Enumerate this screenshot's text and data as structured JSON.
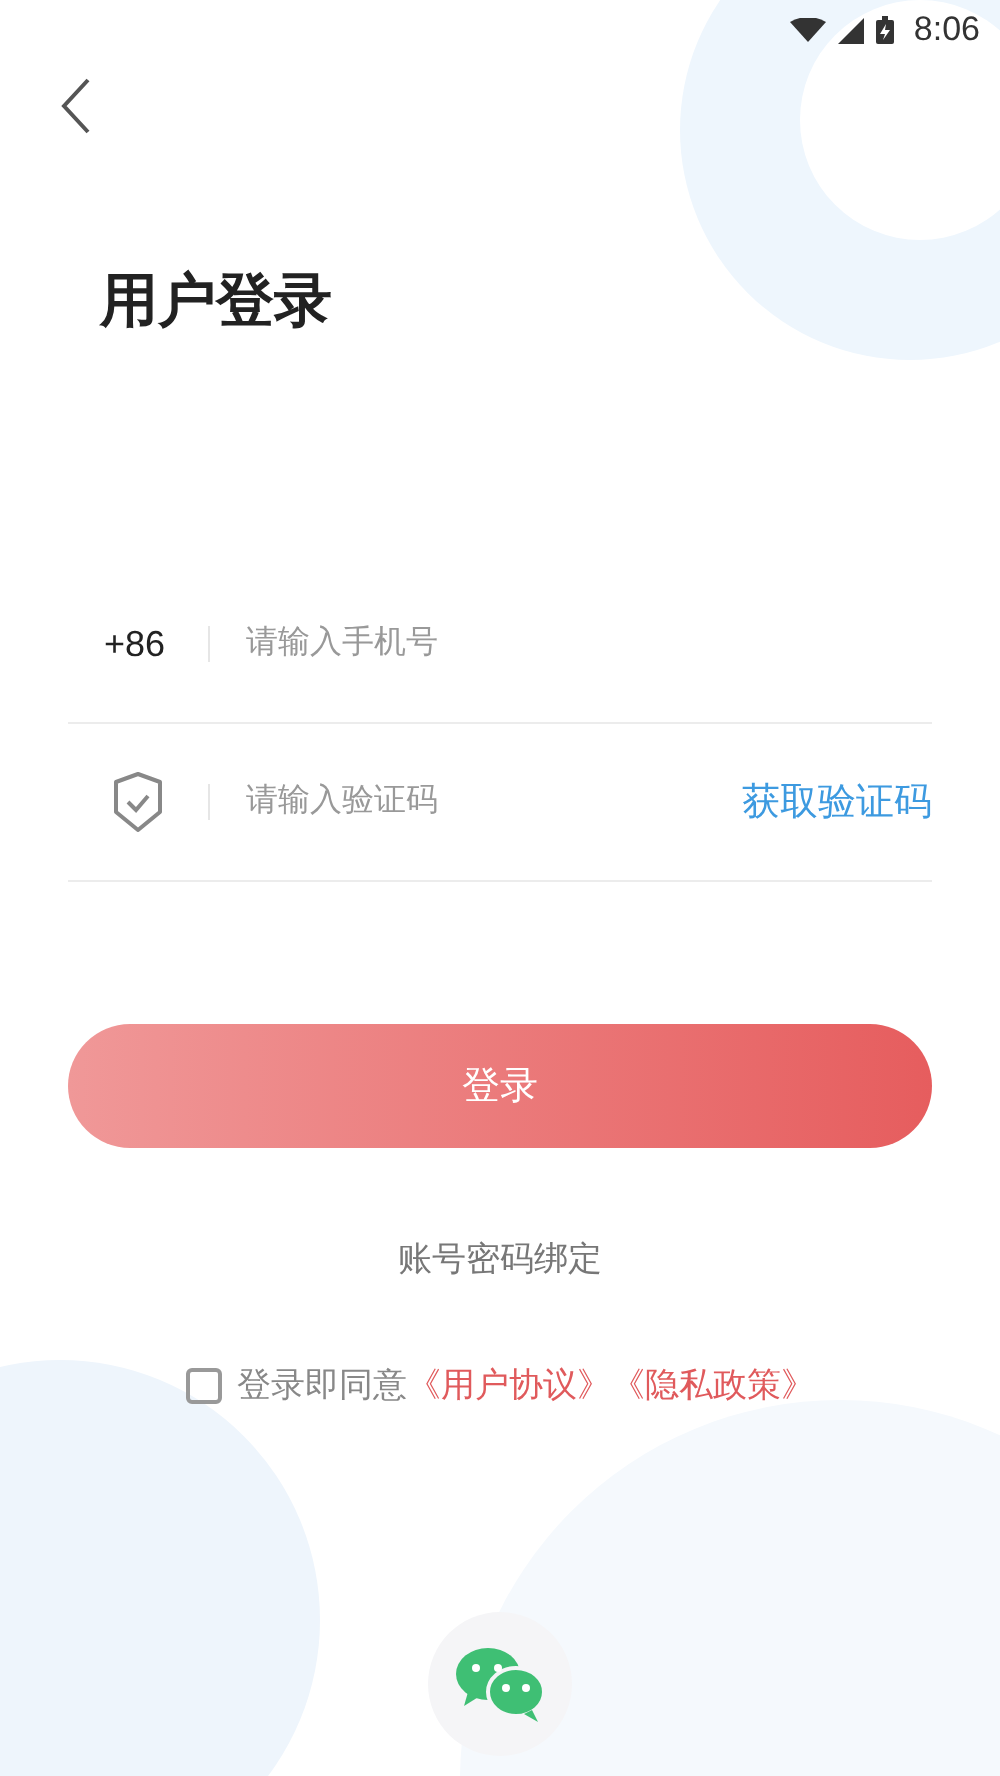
{
  "status_bar": {
    "time": "8:06"
  },
  "title": "用户登录",
  "phone": {
    "prefix": "+86",
    "placeholder": "请输入手机号"
  },
  "code": {
    "placeholder": "请输入验证码",
    "action": "获取验证码"
  },
  "login_button": "登录",
  "bind_link": "账号密码绑定",
  "agreement": {
    "checked": false,
    "text": "登录即同意",
    "links": [
      "《用户协议》",
      "《隐私政策》"
    ]
  },
  "social_login": [
    {
      "kind": "wechat"
    }
  ]
}
